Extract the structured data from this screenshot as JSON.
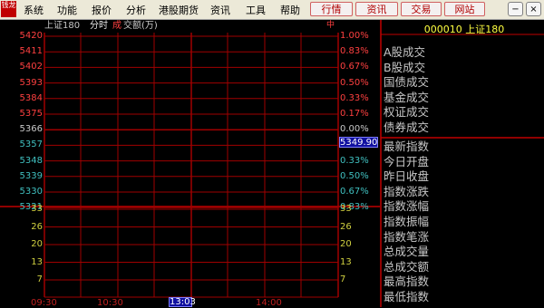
{
  "menubar": {
    "logo": "钱龙",
    "items": [
      "系统",
      "功能",
      "报价",
      "分析",
      "港股期货",
      "资讯",
      "工具",
      "帮助"
    ],
    "buttons": [
      "行情",
      "资讯",
      "交易",
      "网站"
    ],
    "window_controls": [
      "−",
      "×"
    ]
  },
  "chart": {
    "index_name": "上证180",
    "mode": "分时",
    "volume_label_a": "成",
    "volume_label_b": "交额(万)",
    "corner_mark": "中",
    "price_labels": [
      "5420",
      "5411",
      "5402",
      "5393",
      "5384",
      "5375",
      "5366",
      "5357",
      "5348",
      "5339",
      "5330",
      "5321"
    ],
    "pct_labels": [
      "1.00%",
      "0.83%",
      "0.67%",
      "0.50%",
      "0.33%",
      "0.17%",
      "0.00%",
      "0.17%",
      "0.33%",
      "0.50%",
      "0.67%",
      "0.83%"
    ],
    "volume_labels": [
      "33",
      "26",
      "20",
      "13",
      "7"
    ],
    "current_price": "5349.90",
    "time_labels": [
      "09:30",
      "10:30",
      "14:00"
    ],
    "current_time": "13:03"
  },
  "info_panel": {
    "title": "000010 上证180",
    "top_labels": [
      "A股成交",
      "B股成交",
      "国债成交",
      "基金成交",
      "权证成交",
      "债券成交"
    ],
    "bottom_labels": [
      "最新指数",
      "今日开盘",
      "昨日收盘",
      "指数涨跌",
      "指数涨幅",
      "指数振幅",
      "指数笔涨",
      "总成交量",
      "总成交额",
      "最高指数",
      "最低指数"
    ]
  },
  "colors": {
    "grid": "#a00000",
    "up": "#ff4040",
    "flat": "#c8c8c8",
    "down": "#40c0c0",
    "volume": "#d0d040"
  }
}
